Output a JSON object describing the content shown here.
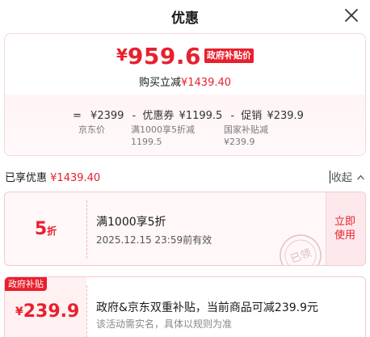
{
  "header": {
    "title": "优惠",
    "close_icon": "close-icon"
  },
  "summary": {
    "currency": "¥",
    "final_price": "959.6",
    "gov_tag": "政府补贴价",
    "buy_prefix": "购买立减",
    "buy_amount": "¥1439.40",
    "calc": {
      "eq": "=",
      "jd_price": "¥2399",
      "minus1": "-",
      "coupon_label": "优惠券",
      "coupon_value": "¥1199.5",
      "minus2": "-",
      "promo_label": "促销",
      "promo_value": "¥239.9"
    },
    "sub": {
      "jd_price_label": "京东价",
      "coupon_desc": "满1000享5折减",
      "coupon_desc_value": "1199.5",
      "gov_desc": "国家补贴减",
      "gov_desc_value": "¥239.9"
    }
  },
  "discount_row": {
    "label": "已享优惠",
    "amount": "¥1439.40",
    "collapse": "收起"
  },
  "coupon": {
    "value": "5",
    "unit": "折",
    "desc": "满1000享5折",
    "valid": "2025.12.15 23:59前有效",
    "use_line1": "立即",
    "use_line2": "使用",
    "stamp_text": "已领"
  },
  "gov_subsidy": {
    "tag": "政府补贴",
    "currency": "¥",
    "amount": "239.9",
    "desc": "政府&京东双重补贴，当前商品可减239.9元",
    "note": "该活动需实名，具体以规则为准"
  },
  "colors": {
    "accent": "#e8202e",
    "tint": "#fff4f5"
  }
}
